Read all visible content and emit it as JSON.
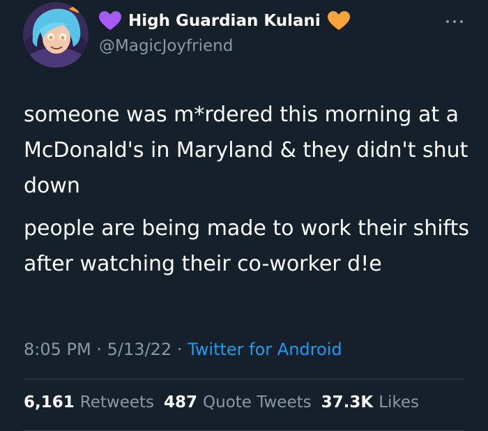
{
  "author": {
    "display_name": "High Guardian Kulani",
    "handle": "@MagicJoyfriend",
    "left_emoji": "purple-heart",
    "right_emoji": "orange-heart"
  },
  "tweet": {
    "paragraphs": [
      "someone was m*rdered this morning at a McDonald's in Maryland & they didn't shut down",
      "people are being made to work their shifts after watching their co-worker d!e"
    ]
  },
  "meta": {
    "time": "8:05 PM",
    "separator1": "·",
    "date": "5/13/22",
    "separator2": "·",
    "source": "Twitter for Android"
  },
  "stats": {
    "retweets_count": "6,161",
    "retweets_label": "Retweets",
    "quotes_count": "487",
    "quotes_label": "Quote Tweets",
    "likes_count": "37.3K",
    "likes_label": "Likes"
  },
  "colors": {
    "background": "#15202b",
    "text": "#ffffff",
    "secondary_text": "#8b98a5",
    "link": "#1d9bf0",
    "purple_heart": "#a45cf4",
    "orange_heart": "#f7a43a",
    "divider": "#38444d"
  }
}
